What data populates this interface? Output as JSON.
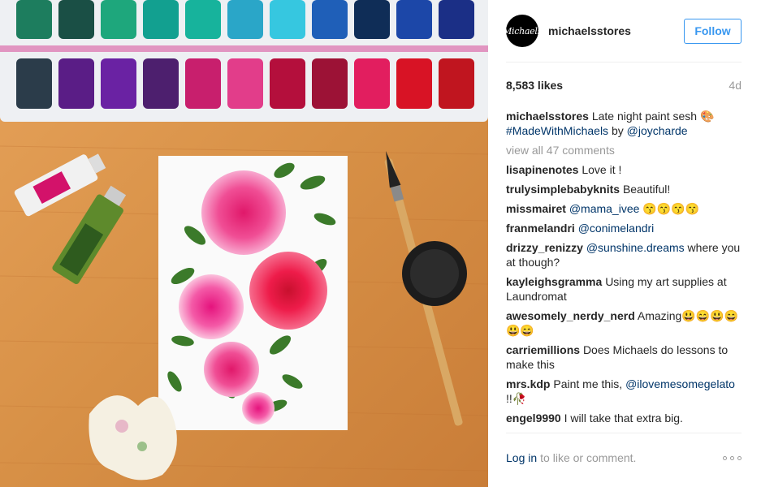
{
  "post": {
    "username": "michaelsstores",
    "avatar_text": "Michaels",
    "follow_label": "Follow",
    "likes": "8,583 likes",
    "time_ago": "4d",
    "caption": {
      "user": "michaelsstores",
      "text": "Late night paint sesh",
      "emoji": "🎨",
      "hashtag": "#MadeWithMichaels",
      "by": "by",
      "mention": "@joycharde"
    },
    "view_all": "view all 47 comments",
    "comments": [
      {
        "user": "lisapinenotes",
        "parts": [
          {
            "t": "Love it !"
          }
        ]
      },
      {
        "user": "trulysimplebabyknits",
        "parts": [
          {
            "t": "Beautiful!"
          }
        ]
      },
      {
        "user": "missmairet",
        "parts": [
          {
            "t": "@mama_ivee",
            "link": true
          },
          {
            "t": "😙😙😙😙"
          }
        ]
      },
      {
        "user": "franmelandri",
        "parts": [
          {
            "t": "@conimelandri",
            "link": true
          }
        ]
      },
      {
        "user": "drizzy_renizzy",
        "parts": [
          {
            "t": "@sunshine.dreams",
            "link": true
          },
          {
            "t": "where you at though?"
          }
        ]
      },
      {
        "user": "kayleighsgramma",
        "parts": [
          {
            "t": "Using my art supplies at Laundromat"
          }
        ]
      },
      {
        "user": "awesomely_nerdy_nerd",
        "parts": [
          {
            "t": "Amazing😃😄😃😄😃😄"
          }
        ]
      },
      {
        "user": "carriemillions",
        "parts": [
          {
            "t": "Does Michaels do lessons to make this"
          }
        ]
      },
      {
        "user": "mrs.kdp",
        "parts": [
          {
            "t": "Paint me this,"
          },
          {
            "t": "@ilovemesomegelato",
            "link": true
          },
          {
            "t": "!!🥀"
          }
        ]
      },
      {
        "user": "engel9990",
        "parts": [
          {
            "t": "I will take that extra big."
          }
        ]
      }
    ],
    "footer": {
      "login": "Log in",
      "rest": "to like or comment."
    }
  },
  "colors": {
    "accent": "#3897f0",
    "link": "#003569",
    "muted": "#999999"
  },
  "icons": [
    "more-options-icon"
  ]
}
